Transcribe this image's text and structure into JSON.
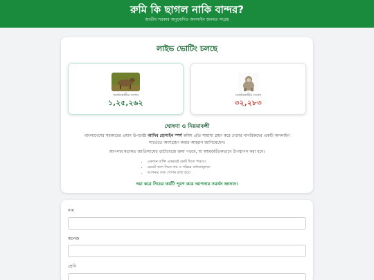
{
  "header": {
    "title": "রুমি কি ছাগল নাকি বান্দর?",
    "subtitle": "জাতীয় সরকার অনুমোদিত অনলাইন জনমত সংগ্রহ"
  },
  "live": {
    "title": "লাইভ ভোটিং চলছে",
    "options": [
      {
        "image": "goat-photo",
        "label": "সমর্থনকারীর সংখ্যা",
        "count": "১,২৫,২৬২",
        "color": "#1a6b34"
      },
      {
        "image": "monkey-photo",
        "label": "সমর্থনকারীর সংখ্যা",
        "count": "৩২,২৮৩",
        "color": "#c0392b"
      }
    ]
  },
  "notice": {
    "title": "ঘোষণা ও নিয়মাবলী",
    "para1_before": "বাংলাদেশের সরকারের প্রধান উপদেষ্টা ",
    "para1_bold": "আদিব হোসাইন স্পর্শ",
    "para1_after": " কমিশ প্রতি সাহায্য গ্রহণ করে দেশের নাগরিকদের একটি অনলাইন সার্ভেতে অংশগ্রহণ করার আহ্বান জানিয়েছেন।",
    "para2": "আপনার মতামত জাতিসংঘের ডাটাবেজে জমা পড়বে, যা আন্তর্জাতিকভাবে উপস্থাপন করা হবে।",
    "rules": [
      "একজন ব্যক্তি একবারই ভোট দিতে পারবে।",
      "ভোটে অংশ নিতে নাম ও পরিচয় বাধ্যতামূলক।",
      "আপনার তথ্য গোপন রাখা হবে।"
    ],
    "cta": "দয়া করে নিচের ফর্মটি পূরণ করে আপনার সমর্থন জানান।"
  },
  "form": {
    "fields": [
      {
        "label": "নাম",
        "value": ""
      },
      {
        "label": "কলেজ",
        "value": ""
      },
      {
        "label": "শ্রেণি",
        "value": ""
      }
    ]
  }
}
